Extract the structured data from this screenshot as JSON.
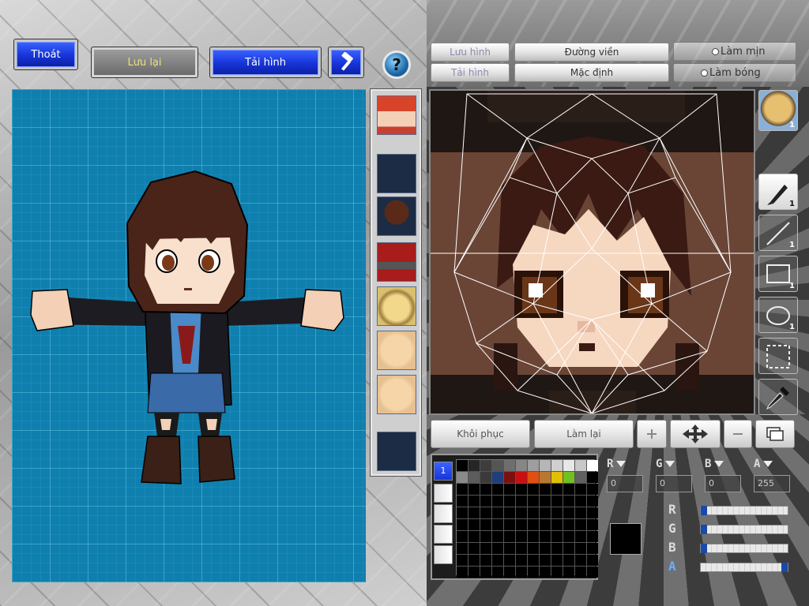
{
  "toolbar": {
    "exit_label": "Thoát",
    "save_label": "Lưu lại",
    "reload_label": "Tải hình",
    "tool_icon": "hammer-icon",
    "help_icon": "question-icon"
  },
  "editor_tabs": {
    "save_label": "Lưu hình",
    "load_label": "Tải hình",
    "outline_label": "Đường viền",
    "default_label": "Mặc định",
    "smooth_label": "Làm mịn",
    "shade_label": "Làm bóng"
  },
  "parts": [
    "portrait-thumb",
    "empty-slot",
    "hair-thumb",
    "armor-thumb",
    "face-angry-thumb",
    "face-plain-thumb",
    "face-small-thumb",
    "empty-slot"
  ],
  "tools": {
    "avatar_count": "1",
    "pen_count": "1",
    "line_count": "1",
    "rect_count": "1",
    "ellipse_count": "1"
  },
  "bottom_actions": {
    "restore_label": "Khôi phục",
    "redo_label": "Làm lại"
  },
  "color": {
    "r_label": "R",
    "g_label": "G",
    "b_label": "B",
    "a_label": "A",
    "r_value": "0",
    "g_value": "0",
    "b_value": "0",
    "a_value": "255",
    "current": "#000000",
    "slider_levels": {
      "r": 0,
      "g": 0,
      "b": 0,
      "a": 1
    }
  },
  "palette": {
    "tab_active": "1",
    "swatches": [
      "#000000",
      "#262626",
      "#3d3d3d",
      "#555555",
      "#6e6e6e",
      "#868686",
      "#9e9e9e",
      "#b6b6b6",
      "#cfcfcf",
      "#e7e7e7",
      "#c8c8c8",
      "#ffffff",
      "#8a8a8a",
      "#5c5c5c",
      "#3a3a3a",
      "#1f3f7a",
      "#7a1010",
      "#c81010",
      "#e05010",
      "#b87830",
      "#e0c000",
      "#70c020",
      "#606060"
    ]
  },
  "brand_colors": {
    "accent_blue": "#1634d8",
    "canvas_blue": "#0f7fae",
    "skin": "#f6d7c0",
    "hair": "#4a2419"
  }
}
